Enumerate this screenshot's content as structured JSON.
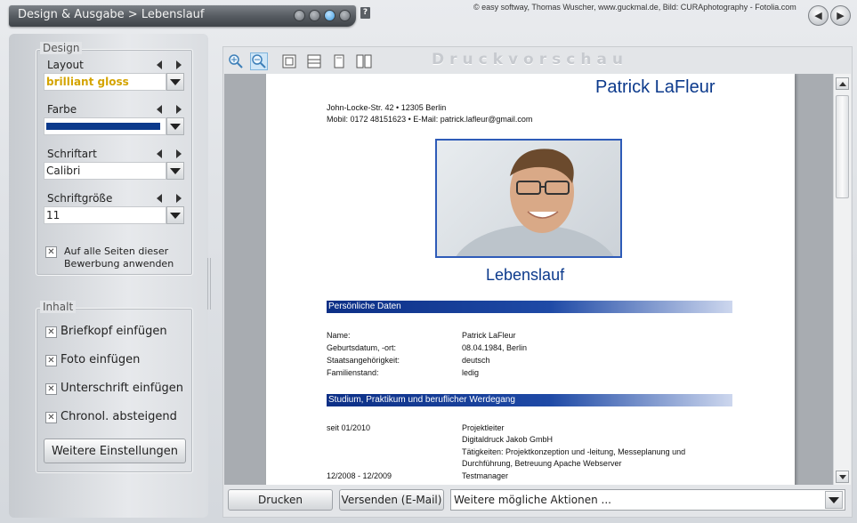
{
  "titlebar": {
    "title": "Design & Ausgabe > Lebenslauf",
    "window_buttons": 4
  },
  "help_label": "?",
  "credits": "© easy softway, Thomas Wuscher, www.guckmal.de, Bild: CURAphotography - Fotolia.com",
  "nav": {
    "back_icon": "arrow-left-icon",
    "forward_icon": "arrow-right-icon"
  },
  "design": {
    "legend": "Design",
    "layout": {
      "label": "Layout",
      "value": "brilliant gloss",
      "value_color": "#d4a400"
    },
    "farbe": {
      "label": "Farbe",
      "swatch_color": "#0c3a8c"
    },
    "schriftart": {
      "label": "Schriftart",
      "value": "Calibri"
    },
    "schriftgroesse": {
      "label": "Schriftgröße",
      "value": "11"
    },
    "apply_all": {
      "label_line1": "Auf alle Seiten dieser",
      "label_line2": "Bewerbung anwenden",
      "checked": true
    }
  },
  "inhalt": {
    "legend": "Inhalt",
    "items": [
      {
        "label": "Briefkopf einfügen",
        "checked": true
      },
      {
        "label": "Foto einfügen",
        "checked": true
      },
      {
        "label": "Unterschrift einfügen",
        "checked": true
      },
      {
        "label": "Chronol. absteigend",
        "checked": true
      }
    ],
    "more_button": "Weitere Einstellungen"
  },
  "preview": {
    "header_label": "Druckvorschau",
    "toolbar_icons": [
      "zoom-in-icon",
      "zoom-out-icon",
      "fit-page-icon",
      "fit-width-icon",
      "single-page-icon",
      "two-pages-icon"
    ],
    "document": {
      "name": "Patrick LaFleur",
      "address": "John-Locke-Str. 42  •  12305 Berlin",
      "contact": "Mobil: 0172 48151623  •  E-Mail: patrick.lafleur@gmail.com",
      "heading": "Lebenslauf",
      "sections": [
        {
          "title": "Persönliche Daten",
          "rows": [
            {
              "label": "Name:",
              "value": "Patrick LaFleur"
            },
            {
              "label": "Geburtsdatum, -ort:",
              "value": "08.04.1984, Berlin"
            },
            {
              "label": "Staatsangehörigkeit:",
              "value": "deutsch"
            },
            {
              "label": "Familienstand:",
              "value": "ledig"
            }
          ]
        },
        {
          "title": "Studium, Praktikum und beruflicher Werdegang",
          "entries": [
            {
              "date": "seit 01/2010",
              "lines": [
                "Projektleiter",
                "Digitaldruck Jakob GmbH",
                "Tätigkeiten: Projektkonzeption und -leitung, Messeplanung und",
                "Durchführung, Betreuung Apache Webserver"
              ]
            },
            {
              "date": "12/2008 - 12/2009",
              "lines": [
                "Testmanager"
              ]
            }
          ]
        }
      ]
    }
  },
  "bottom": {
    "print_button": "Drucken",
    "send_button": "Versenden (E-Mail)",
    "actions_value": "Weitere mögliche Aktionen ..."
  }
}
